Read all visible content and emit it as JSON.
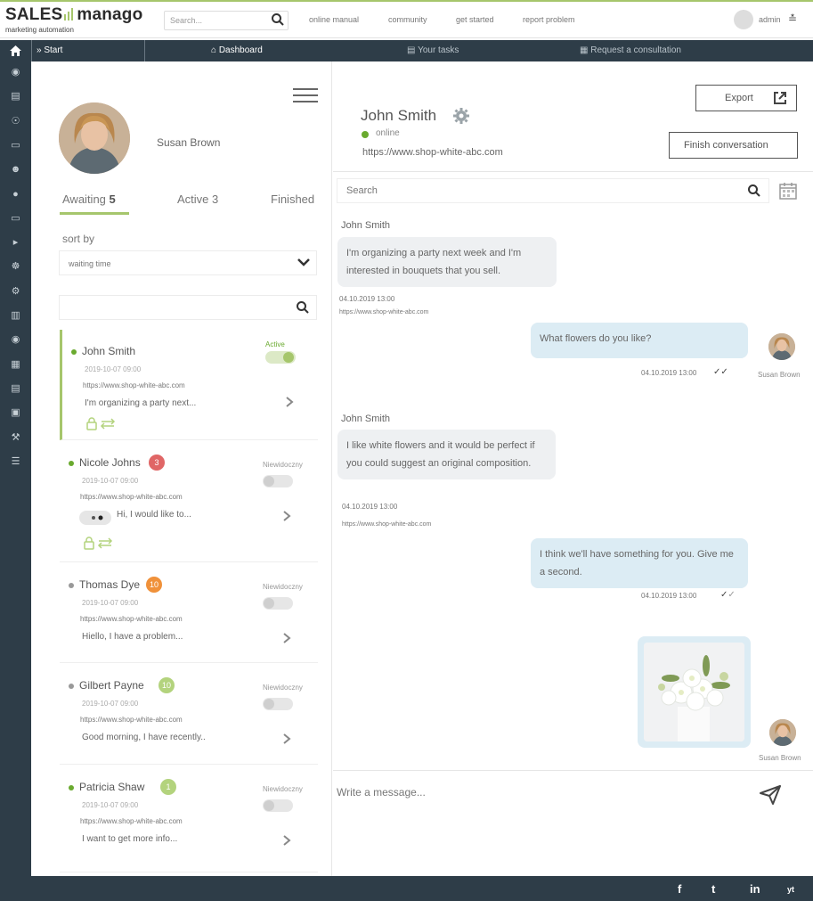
{
  "header": {
    "logo_main": "SALES",
    "logo_accent": "manago",
    "logo_sub": "marketing automation",
    "search_placeholder": "Search...",
    "links": [
      "online manual",
      "community",
      "get started",
      "report problem"
    ],
    "user": "admin"
  },
  "nav": {
    "start": "Start",
    "dashboard": "Dashboard",
    "tasks": "Your tasks",
    "consultation": "Request a consultation"
  },
  "sidebar_icons": [
    "eye-icon",
    "id-card-icon",
    "globe-icon",
    "tablet-icon",
    "user-plus-icon",
    "chat-icon",
    "laptop-icon",
    "megaphone-icon",
    "users-icon",
    "cogs-icon",
    "chart-icon",
    "dots-icon",
    "calendar-icon",
    "database-icon",
    "copy-icon",
    "wrench-icon",
    "sliders-icon"
  ],
  "agent": {
    "name": "Susan Brown"
  },
  "tabs": [
    {
      "label": "Awaiting",
      "count": "5"
    },
    {
      "label": "Active",
      "count": "3"
    },
    {
      "label": "Finished",
      "count": ""
    }
  ],
  "sort": {
    "label": "sort by",
    "value": "waiting time"
  },
  "contacts": [
    {
      "name": "John Smith",
      "badge": "",
      "date": "2019-10-07 09:00",
      "url": "https://www.shop-white-abc.com",
      "message": "I'm organizing a party next...",
      "status": "Active",
      "status_color": "#6aaa2f",
      "dot": "#6aaa2f"
    },
    {
      "name": "Nicole Johns",
      "badge": "3",
      "badge_color": "#e06666",
      "date": "2019-10-07 09:00",
      "url": "https://www.shop-white-abc.com",
      "message": "Hi, I would like to...",
      "status": "Niewidoczny",
      "status_color": "#999999",
      "dot": "#6aaa2f"
    },
    {
      "name": "Thomas Dye",
      "badge": "10",
      "badge_color": "#f0913a",
      "date": "2019-10-07 09:00",
      "url": "https://www.shop-white-abc.com",
      "message": "Hiello, I have a problem...",
      "status": "Niewidoczny",
      "status_color": "#999999",
      "dot": "#999999"
    },
    {
      "name": "Gilbert Payne",
      "badge": "10",
      "badge_color": "#b3d37d",
      "date": "2019-10-07 09:00",
      "url": "https://www.shop-white-abc.com",
      "message": "Good morning, I have recently..",
      "status": "Niewidoczny",
      "status_color": "#999999",
      "dot": "#999999"
    },
    {
      "name": "Patricia Shaw",
      "badge": "1",
      "badge_color": "#b3d37d",
      "date": "2019-10-07 09:00",
      "url": "https://www.shop-white-abc.com",
      "message": "I want to get more info...",
      "status": "Niewidoczny",
      "status_color": "#999999",
      "dot": "#6aaa2f"
    }
  ],
  "chat": {
    "name": "John Smith",
    "status": "online",
    "url": "https://www.shop-white-abc.com",
    "export_label": "Export",
    "finish_label": "Finish conversation",
    "search_placeholder": "Search",
    "messages": [
      {
        "sender": "John Smith",
        "text": "I'm organizing a party next week and I'm interested in bouquets that you sell.",
        "time": "04.10.2019 13:00",
        "url": "https://www.shop-white-abc.com"
      },
      {
        "text": "What flowers do you like?",
        "time": "04.10.2019 13:00",
        "agent": "Susan Brown"
      },
      {
        "sender": "John Smith",
        "text": "I like white flowers and it would be perfect if you could suggest an original composition.",
        "time": "04.10.2019 13:00",
        "url": "https://www.shop-white-abc.com"
      },
      {
        "text": "I think we'll have something for you. Give me a second.",
        "time": "04.10.2019 13:00"
      },
      {
        "agent": "Susan Brown"
      }
    ],
    "write_placeholder": "Write a message..."
  },
  "footer": {
    "social": [
      "f",
      "t",
      "in",
      "yt"
    ]
  }
}
